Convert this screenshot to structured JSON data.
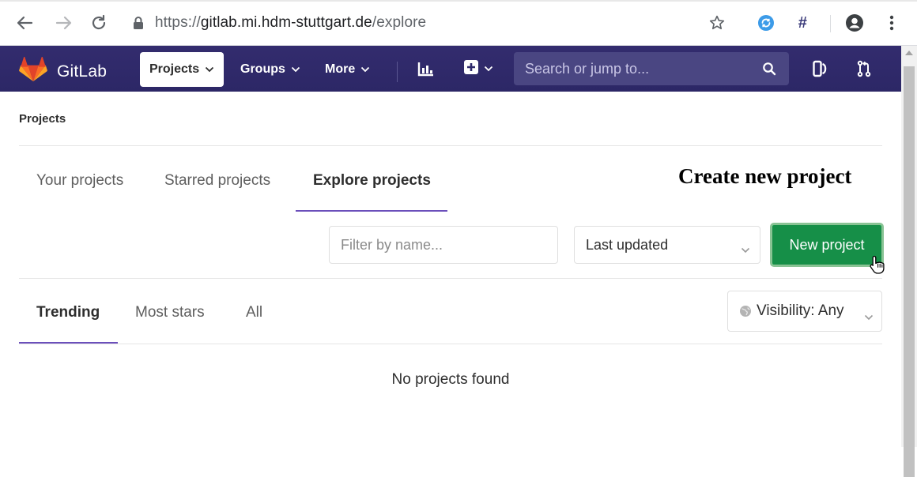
{
  "browser": {
    "url_scheme": "https://",
    "url_host": "gitlab.mi.hdm-stuttgart.de",
    "url_path": "/explore",
    "ext_label": "#"
  },
  "navbar": {
    "brand": "GitLab",
    "projects_label": "Projects",
    "groups_label": "Groups",
    "more_label": "More",
    "search_placeholder": "Search or jump to...",
    "bg_color": "#2f2a6b"
  },
  "page": {
    "breadcrumb": "Projects",
    "tabs": [
      "Your projects",
      "Starred projects",
      "Explore projects"
    ],
    "active_tab": "Explore projects",
    "annotation": "Create new project",
    "filter_placeholder": "Filter by name...",
    "sort_value": "Last updated",
    "new_project_label": "New project",
    "subtabs": [
      "Trending",
      "Most stars",
      "All"
    ],
    "active_subtab": "Trending",
    "visibility_label": "Visibility: Any",
    "empty_message": "No projects found",
    "accent_color": "#6b4fbb",
    "button_color": "#168f48"
  }
}
